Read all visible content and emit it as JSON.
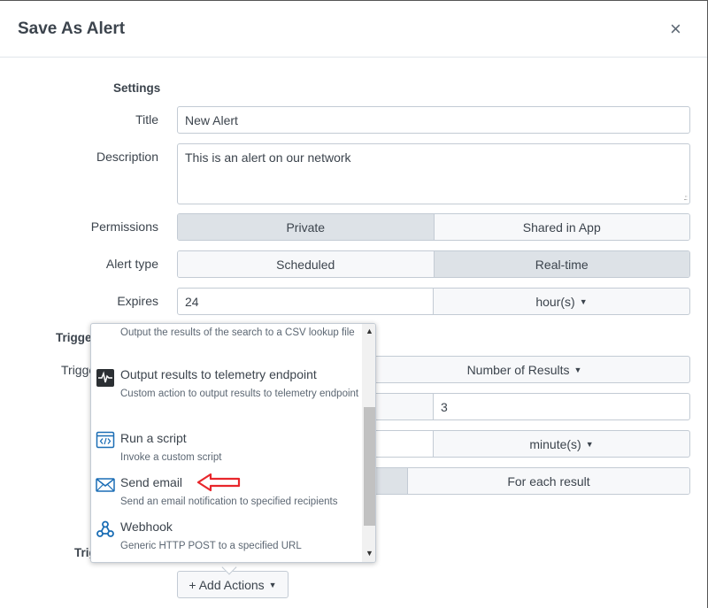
{
  "dialog": {
    "title": "Save As Alert",
    "close_icon": "×"
  },
  "settings": {
    "section_title": "Settings",
    "title_label": "Title",
    "title_value": "New Alert",
    "description_label": "Description",
    "description_value": "This is an alert on our network",
    "permissions_label": "Permissions",
    "permissions_options": [
      "Private",
      "Shared in App"
    ],
    "permissions_selected": "Private",
    "alert_type_label": "Alert type",
    "alert_type_options": [
      "Scheduled",
      "Real-time"
    ],
    "alert_type_selected": "Real-time",
    "expires_label": "Expires",
    "expires_value": "24",
    "expires_unit": "hour(s)"
  },
  "trigger": {
    "section_title_partial": "Trigge",
    "trigger_label_partial": "Trigge",
    "trigger_condition": "Number of Results",
    "trigger_value": "3",
    "throttle_unit": "minute(s)",
    "trigger_mode_visible": "For each result",
    "trigger_actions_partial": "Trig"
  },
  "actions": {
    "add_button": "+ Add Actions",
    "dropdown_items": [
      {
        "name": "",
        "description": "Output the results of the search to a CSV lookup file",
        "icon": "lookup-icon"
      },
      {
        "name": "Output results to telemetry endpoint",
        "description": "Custom action to output results to telemetry endpoint",
        "icon": "telemetry-icon"
      },
      {
        "name": "Run a script",
        "description": "Invoke a custom script",
        "icon": "script-icon"
      },
      {
        "name": "Send email",
        "description": "Send an email notification to specified recipients",
        "icon": "email-icon"
      },
      {
        "name": "Webhook",
        "description": "Generic HTTP POST to a specified URL",
        "icon": "webhook-icon"
      }
    ]
  },
  "colors": {
    "annotation_arrow": "#e8262b",
    "icon_blue": "#1a6db5"
  }
}
